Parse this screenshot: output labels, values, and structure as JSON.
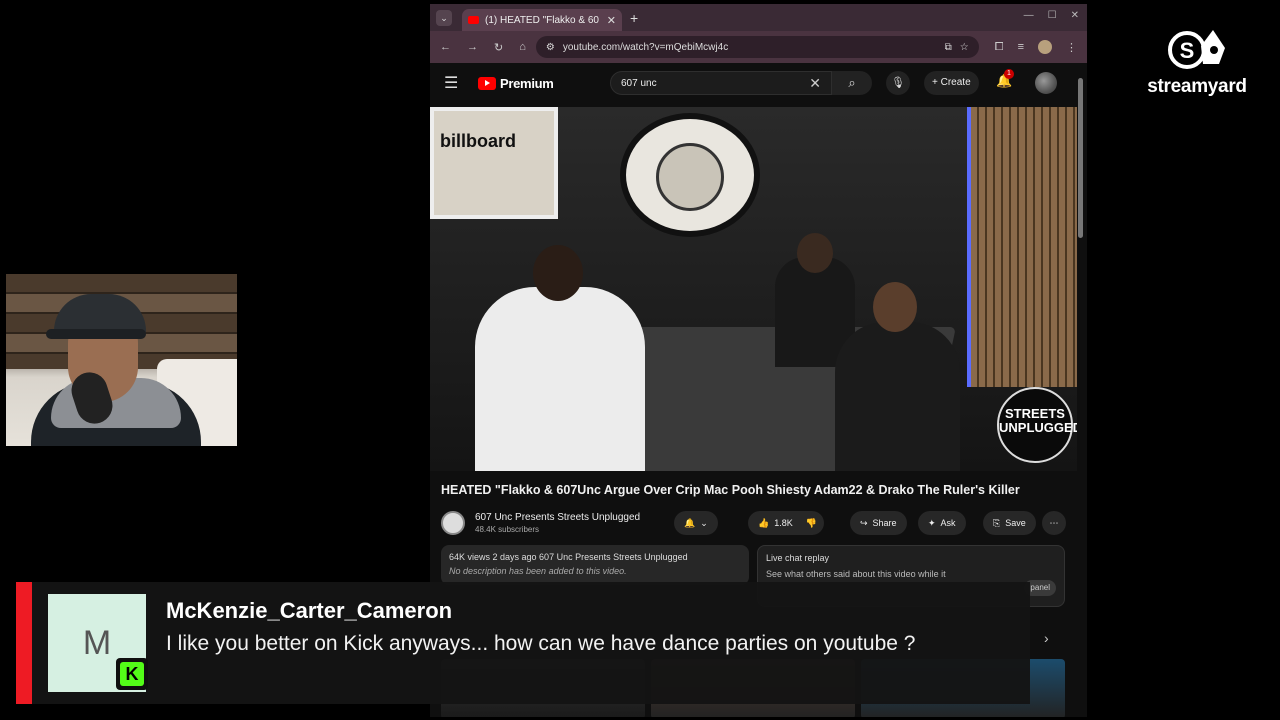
{
  "overlay": {
    "brand": "streamyard",
    "comment": {
      "avatar_letter": "M",
      "platform_icon": "kick-icon",
      "author": "McKenzie_Carter_Cameron",
      "message": "I like you better on Kick anyways... how can we have dance parties on youtube ?",
      "accent_color": "#ee1b24"
    }
  },
  "browser": {
    "tab_title": "(1) HEATED \"Flakko & 60",
    "url": "youtube.com/watch?v=mQebiMcwj4c"
  },
  "youtube": {
    "logo_label": "Premium",
    "search_query": "607 unc",
    "create_label": "Create",
    "notification_count": "1",
    "video": {
      "title": "HEATED \"Flakko & 607Unc Argue Over Crip Mac Pooh Shiesty Adam22 & Drako The Ruler's Killer",
      "watermark": "STREETS UNPLUGGED",
      "poster_text": "billboard"
    },
    "channel": {
      "name": "607 Unc Presents Streets Unplugged",
      "subscribers": "48.4K subscribers"
    },
    "actions": {
      "likes": "1.8K",
      "share": "Share",
      "ask": "Ask",
      "save": "Save"
    },
    "description": {
      "meta": "64K views  2 days ago  607 Unc Presents Streets Unplugged",
      "text": "No description has been added to this video."
    },
    "live_chat": {
      "title": "Live chat replay",
      "subtitle": "See what others said about this video while it",
      "button": "panel"
    }
  }
}
